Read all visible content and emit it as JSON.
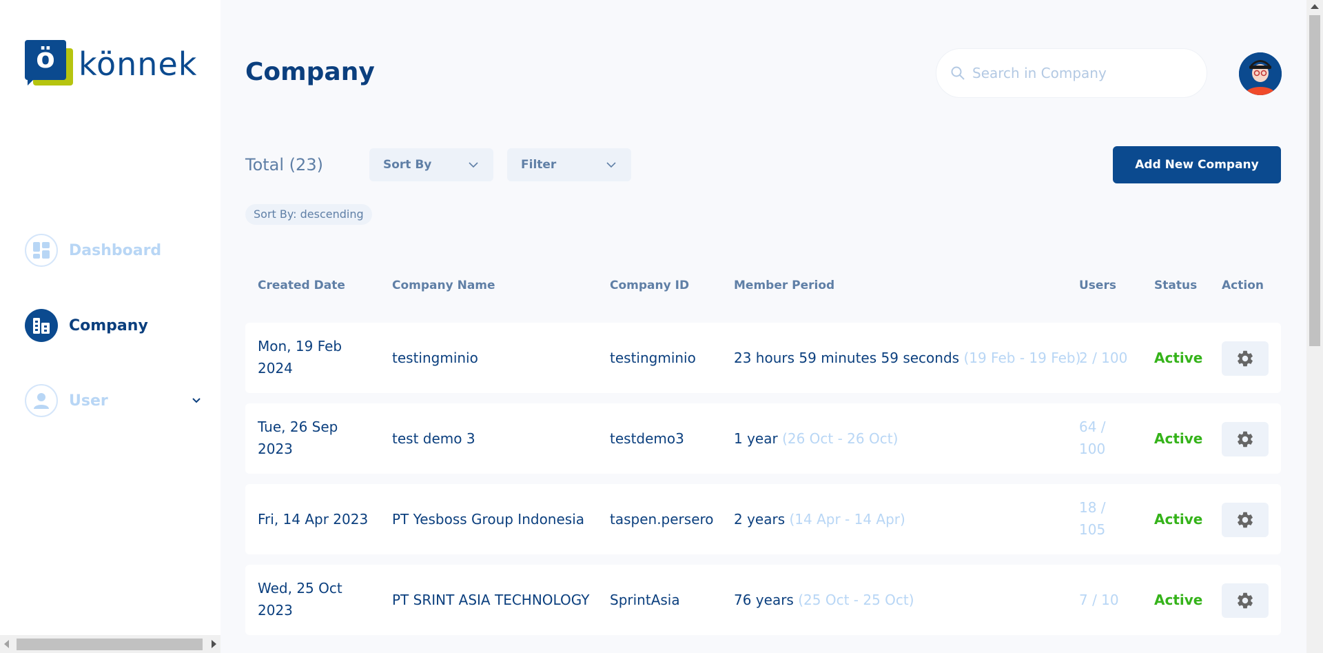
{
  "brand": {
    "name": "könnek",
    "mark_letter": "ö"
  },
  "sidebar": {
    "items": [
      {
        "label": "Dashboard",
        "icon": "dashboard-icon",
        "active": false
      },
      {
        "label": "Company",
        "icon": "building-icon",
        "active": true
      },
      {
        "label": "User",
        "icon": "user-icon",
        "active": false,
        "expandable": true
      }
    ]
  },
  "header": {
    "title": "Company",
    "search_placeholder": "Search in Company"
  },
  "toolbar": {
    "total": "Total (23)",
    "sort_label": "Sort By",
    "filter_label": "Filter",
    "add_label": "Add New Company",
    "sort_chip": "Sort By: descending"
  },
  "table": {
    "columns": [
      "Created Date",
      "Company Name",
      "Company ID",
      "Member Period",
      "Users",
      "Status",
      "Action"
    ],
    "rows": [
      {
        "date_line1": "Mon, 19 Feb",
        "date_line2": "2024",
        "name": "testingminio",
        "id": "testingminio",
        "period": "23 hours 59 minutes 59 seconds",
        "range": "(19 Feb - 19 Feb)",
        "users_line1": "2 / 100",
        "users_line2": "",
        "status": "Active"
      },
      {
        "date_line1": "Tue, 26 Sep",
        "date_line2": "2023",
        "name": "test demo 3",
        "id": "testdemo3",
        "period": "1 year",
        "range": "(26 Oct - 26 Oct)",
        "users_line1": "64 /",
        "users_line2": "100",
        "status": "Active"
      },
      {
        "date_line1": "Fri, 14 Apr 2023",
        "date_line2": "",
        "name": "PT Yesboss Group Indonesia",
        "id": "taspen.persero",
        "period": "2 years",
        "range": "(14 Apr - 14 Apr)",
        "users_line1": "18 /",
        "users_line2": "105",
        "status": "Active"
      },
      {
        "date_line1": "Wed, 25 Oct",
        "date_line2": "2023",
        "name": "PT SRINT ASIA TECHNOLOGY",
        "id": "SprintAsia",
        "period": "76 years",
        "range": "(25 Oct - 25 Oct)",
        "users_line1": "7 / 10",
        "users_line2": "",
        "status": "Active"
      }
    ]
  },
  "colors": {
    "primary": "#0b4a8f",
    "accent": "#b6c40f",
    "active_status": "#35b31a",
    "muted": "#b8d6f5"
  }
}
